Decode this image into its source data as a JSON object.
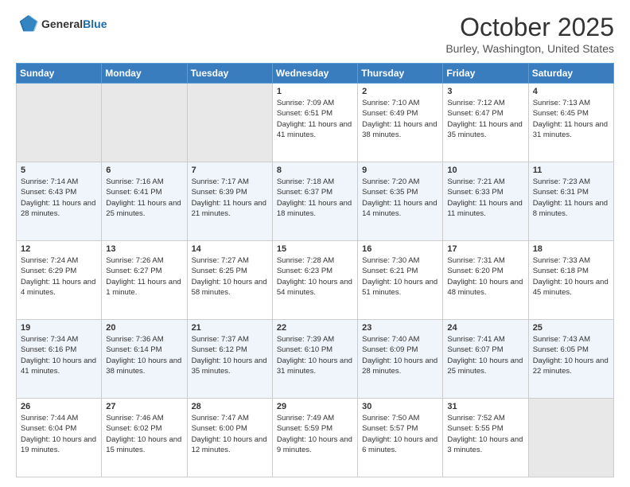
{
  "header": {
    "logo_general": "General",
    "logo_blue": "Blue",
    "month": "October 2025",
    "location": "Burley, Washington, United States"
  },
  "days_of_week": [
    "Sunday",
    "Monday",
    "Tuesday",
    "Wednesday",
    "Thursday",
    "Friday",
    "Saturday"
  ],
  "weeks": [
    [
      {
        "day": "",
        "info": ""
      },
      {
        "day": "",
        "info": ""
      },
      {
        "day": "",
        "info": ""
      },
      {
        "day": "1",
        "info": "Sunrise: 7:09 AM\nSunset: 6:51 PM\nDaylight: 11 hours and 41 minutes."
      },
      {
        "day": "2",
        "info": "Sunrise: 7:10 AM\nSunset: 6:49 PM\nDaylight: 11 hours and 38 minutes."
      },
      {
        "day": "3",
        "info": "Sunrise: 7:12 AM\nSunset: 6:47 PM\nDaylight: 11 hours and 35 minutes."
      },
      {
        "day": "4",
        "info": "Sunrise: 7:13 AM\nSunset: 6:45 PM\nDaylight: 11 hours and 31 minutes."
      }
    ],
    [
      {
        "day": "5",
        "info": "Sunrise: 7:14 AM\nSunset: 6:43 PM\nDaylight: 11 hours and 28 minutes."
      },
      {
        "day": "6",
        "info": "Sunrise: 7:16 AM\nSunset: 6:41 PM\nDaylight: 11 hours and 25 minutes."
      },
      {
        "day": "7",
        "info": "Sunrise: 7:17 AM\nSunset: 6:39 PM\nDaylight: 11 hours and 21 minutes."
      },
      {
        "day": "8",
        "info": "Sunrise: 7:18 AM\nSunset: 6:37 PM\nDaylight: 11 hours and 18 minutes."
      },
      {
        "day": "9",
        "info": "Sunrise: 7:20 AM\nSunset: 6:35 PM\nDaylight: 11 hours and 14 minutes."
      },
      {
        "day": "10",
        "info": "Sunrise: 7:21 AM\nSunset: 6:33 PM\nDaylight: 11 hours and 11 minutes."
      },
      {
        "day": "11",
        "info": "Sunrise: 7:23 AM\nSunset: 6:31 PM\nDaylight: 11 hours and 8 minutes."
      }
    ],
    [
      {
        "day": "12",
        "info": "Sunrise: 7:24 AM\nSunset: 6:29 PM\nDaylight: 11 hours and 4 minutes."
      },
      {
        "day": "13",
        "info": "Sunrise: 7:26 AM\nSunset: 6:27 PM\nDaylight: 11 hours and 1 minute."
      },
      {
        "day": "14",
        "info": "Sunrise: 7:27 AM\nSunset: 6:25 PM\nDaylight: 10 hours and 58 minutes."
      },
      {
        "day": "15",
        "info": "Sunrise: 7:28 AM\nSunset: 6:23 PM\nDaylight: 10 hours and 54 minutes."
      },
      {
        "day": "16",
        "info": "Sunrise: 7:30 AM\nSunset: 6:21 PM\nDaylight: 10 hours and 51 minutes."
      },
      {
        "day": "17",
        "info": "Sunrise: 7:31 AM\nSunset: 6:20 PM\nDaylight: 10 hours and 48 minutes."
      },
      {
        "day": "18",
        "info": "Sunrise: 7:33 AM\nSunset: 6:18 PM\nDaylight: 10 hours and 45 minutes."
      }
    ],
    [
      {
        "day": "19",
        "info": "Sunrise: 7:34 AM\nSunset: 6:16 PM\nDaylight: 10 hours and 41 minutes."
      },
      {
        "day": "20",
        "info": "Sunrise: 7:36 AM\nSunset: 6:14 PM\nDaylight: 10 hours and 38 minutes."
      },
      {
        "day": "21",
        "info": "Sunrise: 7:37 AM\nSunset: 6:12 PM\nDaylight: 10 hours and 35 minutes."
      },
      {
        "day": "22",
        "info": "Sunrise: 7:39 AM\nSunset: 6:10 PM\nDaylight: 10 hours and 31 minutes."
      },
      {
        "day": "23",
        "info": "Sunrise: 7:40 AM\nSunset: 6:09 PM\nDaylight: 10 hours and 28 minutes."
      },
      {
        "day": "24",
        "info": "Sunrise: 7:41 AM\nSunset: 6:07 PM\nDaylight: 10 hours and 25 minutes."
      },
      {
        "day": "25",
        "info": "Sunrise: 7:43 AM\nSunset: 6:05 PM\nDaylight: 10 hours and 22 minutes."
      }
    ],
    [
      {
        "day": "26",
        "info": "Sunrise: 7:44 AM\nSunset: 6:04 PM\nDaylight: 10 hours and 19 minutes."
      },
      {
        "day": "27",
        "info": "Sunrise: 7:46 AM\nSunset: 6:02 PM\nDaylight: 10 hours and 15 minutes."
      },
      {
        "day": "28",
        "info": "Sunrise: 7:47 AM\nSunset: 6:00 PM\nDaylight: 10 hours and 12 minutes."
      },
      {
        "day": "29",
        "info": "Sunrise: 7:49 AM\nSunset: 5:59 PM\nDaylight: 10 hours and 9 minutes."
      },
      {
        "day": "30",
        "info": "Sunrise: 7:50 AM\nSunset: 5:57 PM\nDaylight: 10 hours and 6 minutes."
      },
      {
        "day": "31",
        "info": "Sunrise: 7:52 AM\nSunset: 5:55 PM\nDaylight: 10 hours and 3 minutes."
      },
      {
        "day": "",
        "info": ""
      }
    ]
  ]
}
